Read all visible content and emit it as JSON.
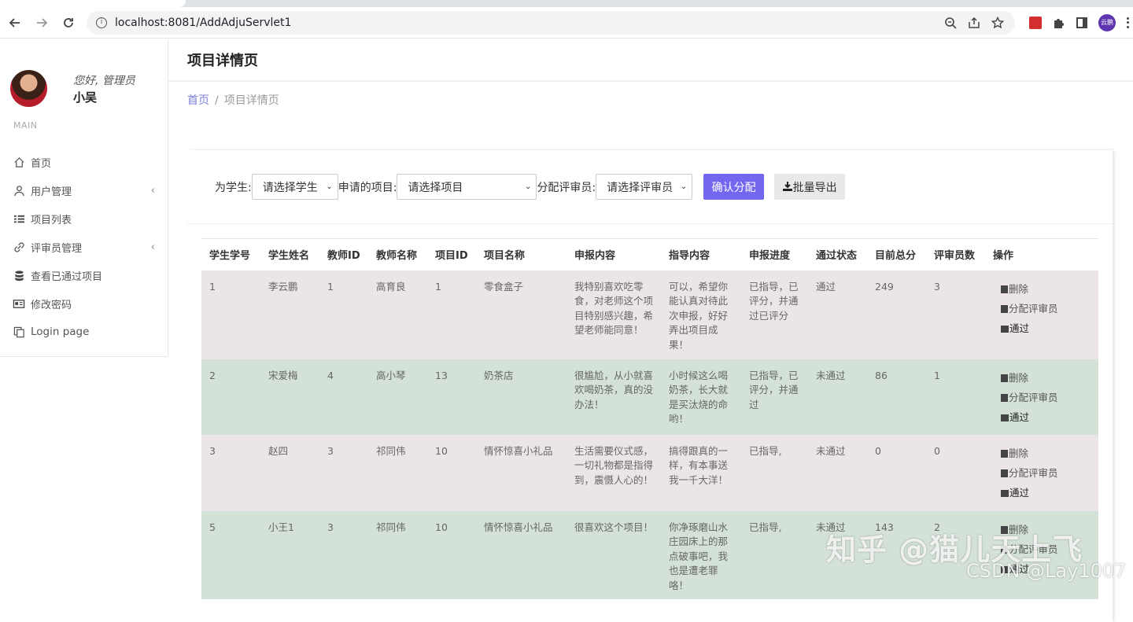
{
  "browser": {
    "url": "localhost:8081/AddAdjuServlet1",
    "profile_label": "云鹏"
  },
  "sidebar": {
    "greeting": "您好, 管理员",
    "username": "小吴",
    "section_label": "MAIN",
    "items": [
      {
        "label": "首页",
        "icon": "home-icon"
      },
      {
        "label": "用户管理",
        "icon": "user-icon",
        "has_submenu": true
      },
      {
        "label": "项目列表",
        "icon": "list-icon"
      },
      {
        "label": "评审员管理",
        "icon": "link-icon",
        "has_submenu": true
      },
      {
        "label": "查看已通过项目",
        "icon": "database-icon"
      },
      {
        "label": "修改密码",
        "icon": "card-icon"
      },
      {
        "label": "Login page",
        "icon": "copy-icon"
      }
    ]
  },
  "header": {
    "title": "项目详情页",
    "breadcrumb_home": "首页",
    "breadcrumb_sep": "/",
    "breadcrumb_current": "项目详情页"
  },
  "filter": {
    "student_label": "为学生:",
    "student_value": "请选择学生",
    "project_label": "申请的项目:",
    "project_value": "请选择项目",
    "reviewer_label": "分配评审员:",
    "reviewer_value": "请选择评审员",
    "confirm_label": "确认分配",
    "export_label": "批量导出"
  },
  "table": {
    "columns": [
      "学生学号",
      "学生姓名",
      "教师ID",
      "教师名称",
      "项目ID",
      "项目名称",
      "申报内容",
      "指导内容",
      "申报进度",
      "通过状态",
      "目前总分",
      "评审员数",
      "操作"
    ],
    "op_delete": "删除",
    "op_assign": "分配评审员",
    "op_pass": "通过",
    "rows": [
      {
        "cells": [
          "1",
          "李云鹏",
          "1",
          "高育良",
          "1",
          "零食盒子",
          "我特别喜欢吃零食，对老师这个项目特别感兴趣，希望老师能同意！",
          "可以，希望你能认真对待此次申报，好好弄出项目成果！",
          "已指导，已评分，并通过已评分",
          "通过",
          "249",
          "3"
        ]
      },
      {
        "cells": [
          "2",
          "宋爱梅",
          "4",
          "高小琴",
          "13",
          "奶茶店",
          "很尴尬，从小就喜欢喝奶茶，真的没办法！",
          "小时候这么喝奶茶，长大就是买汰烧的命哟！",
          "已指导，已评分，并通过",
          "未通过",
          "86",
          "1"
        ]
      },
      {
        "cells": [
          "3",
          "赵四",
          "3",
          "祁同伟",
          "10",
          "情怀惊喜小礼品",
          "生活需要仪式感，一切礼物都是指得到，震慑人心的！",
          "搞得跟真的一样，有本事送我一千大洋！",
          "已指导,",
          "未通过",
          "0",
          "0"
        ]
      },
      {
        "cells": [
          "5",
          "小王1",
          "3",
          "祁同伟",
          "10",
          "情怀惊喜小礼品",
          "很喜欢这个项目！",
          "你净琢磨山水庄园床上的那点破事吧，我也是遭老罪咯！",
          "已指导,",
          "未通过",
          "143",
          "2"
        ]
      }
    ]
  },
  "watermark": {
    "line1": "知乎 @猫儿天上飞",
    "line2": "CSDN @Lay1007"
  }
}
